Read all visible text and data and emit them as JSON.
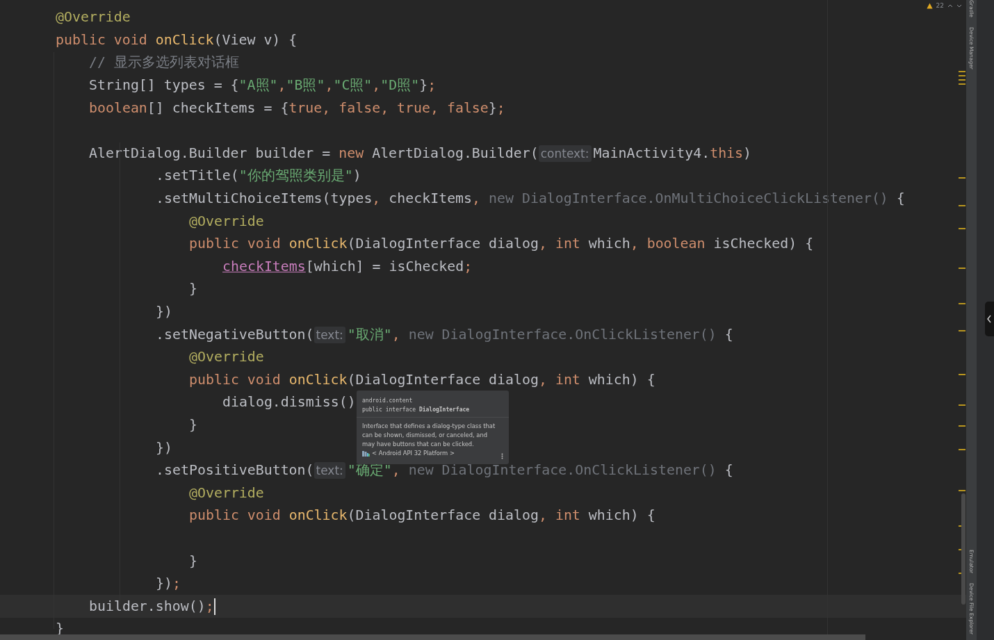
{
  "editor": {
    "lines": [
      {
        "current": false,
        "tokens": [
          {
            "kind": "ann",
            "text": "@Override"
          }
        ]
      },
      {
        "current": false,
        "tokens": [
          {
            "kind": "kw",
            "text": "public void "
          },
          {
            "kind": "fn",
            "text": "onClick"
          },
          {
            "kind": "plain",
            "text": "(View v) {"
          }
        ]
      },
      {
        "current": false,
        "tokens": [
          {
            "kind": "comment",
            "text": "// 显示多选列表对话框"
          }
        ]
      },
      {
        "current": false,
        "tokens": [
          {
            "kind": "plain",
            "text": "String[] types = {"
          },
          {
            "kind": "str",
            "text": "\"A照\""
          },
          {
            "kind": "kw",
            "text": ","
          },
          {
            "kind": "str",
            "text": "\"B照\""
          },
          {
            "kind": "kw",
            "text": ","
          },
          {
            "kind": "str",
            "text": "\"C照\""
          },
          {
            "kind": "kw",
            "text": ","
          },
          {
            "kind": "str",
            "text": "\"D照\""
          },
          {
            "kind": "plain",
            "text": "}"
          },
          {
            "kind": "kw",
            "text": ";"
          }
        ]
      },
      {
        "current": false,
        "tokens": [
          {
            "kind": "kw",
            "text": "boolean"
          },
          {
            "kind": "plain",
            "text": "[] checkItems = {"
          },
          {
            "kind": "kw",
            "text": "true, false, true, false"
          },
          {
            "kind": "plain",
            "text": "}"
          },
          {
            "kind": "kw",
            "text": ";"
          }
        ]
      },
      {
        "current": false
      },
      {
        "current": false,
        "tokens": [
          {
            "kind": "plain",
            "text": "AlertDialog.Builder builder = "
          },
          {
            "kind": "kw",
            "text": "new "
          },
          {
            "kind": "plain",
            "text": "AlertDialog.Builder("
          },
          {
            "kind": "hint",
            "text": "context:"
          },
          {
            "kind": "plain",
            "text": "MainActivity4."
          },
          {
            "kind": "kw",
            "text": "this"
          },
          {
            "kind": "plain",
            "text": ")"
          }
        ]
      },
      {
        "current": false,
        "tokens": [
          {
            "kind": "plain",
            "text": ".setTitle("
          },
          {
            "kind": "str",
            "text": "\"你的驾照类别是\""
          },
          {
            "kind": "plain",
            "text": ")"
          }
        ]
      },
      {
        "current": false,
        "tokens": [
          {
            "kind": "plain",
            "text": ".setMultiChoiceItems(types"
          },
          {
            "kind": "kw",
            "text": ", "
          },
          {
            "kind": "plain",
            "text": "checkItems"
          },
          {
            "kind": "kw",
            "text": ", "
          },
          {
            "kind": "gray",
            "text": "new DialogInterface.OnMultiChoiceClickListener()"
          },
          {
            "kind": "plain",
            "text": " {"
          }
        ]
      },
      {
        "current": false,
        "tokens": [
          {
            "kind": "ann",
            "text": "@Override"
          }
        ]
      },
      {
        "current": false,
        "tokens": [
          {
            "kind": "kw",
            "text": "public void "
          },
          {
            "kind": "fn",
            "text": "onClick"
          },
          {
            "kind": "plain",
            "text": "(DialogInterface dialog"
          },
          {
            "kind": "kw",
            "text": ", int "
          },
          {
            "kind": "plain",
            "text": "which"
          },
          {
            "kind": "kw",
            "text": ", boolean "
          },
          {
            "kind": "plain",
            "text": "isChecked) {"
          }
        ]
      },
      {
        "current": false,
        "tokens": [
          {
            "kind": "field",
            "text": "checkItems"
          },
          {
            "kind": "plain",
            "text": "[which] = isChecked"
          },
          {
            "kind": "kw",
            "text": ";"
          }
        ]
      },
      {
        "current": false,
        "tokens": [
          {
            "kind": "plain",
            "text": "}"
          }
        ]
      },
      {
        "current": false,
        "tokens": [
          {
            "kind": "plain",
            "text": "})"
          }
        ]
      },
      {
        "current": false,
        "tokens": [
          {
            "kind": "plain",
            "text": ".setNegativeButton("
          },
          {
            "kind": "hint",
            "text": "text:"
          },
          {
            "kind": "str",
            "text": "\"取消\""
          },
          {
            "kind": "kw",
            "text": ", "
          },
          {
            "kind": "gray",
            "text": "new DialogInterface.OnClickListener()"
          },
          {
            "kind": "plain",
            "text": " {"
          }
        ]
      },
      {
        "current": false,
        "tokens": [
          {
            "kind": "ann",
            "text": "@Override"
          }
        ]
      },
      {
        "current": false,
        "tokens": [
          {
            "kind": "kw",
            "text": "public void "
          },
          {
            "kind": "fn",
            "text": "onClick"
          },
          {
            "kind": "plain",
            "text": "(DialogInterface dialog"
          },
          {
            "kind": "kw",
            "text": ", int "
          },
          {
            "kind": "plain",
            "text": "which) {"
          }
        ]
      },
      {
        "current": false,
        "tokens": [
          {
            "kind": "plain",
            "text": "dialog.dismiss()"
          }
        ]
      },
      {
        "current": false,
        "tokens": [
          {
            "kind": "plain",
            "text": "}"
          }
        ]
      },
      {
        "current": false,
        "tokens": [
          {
            "kind": "plain",
            "text": "})"
          }
        ]
      },
      {
        "current": false,
        "tokens": [
          {
            "kind": "plain",
            "text": ".setPositiveButton("
          },
          {
            "kind": "hint",
            "text": "text:"
          },
          {
            "kind": "str",
            "text": "\"确定\""
          },
          {
            "kind": "kw",
            "text": ", "
          },
          {
            "kind": "gray",
            "text": "new DialogInterface.OnClickListener()"
          },
          {
            "kind": "plain",
            "text": " {"
          }
        ]
      },
      {
        "current": false,
        "tokens": [
          {
            "kind": "ann",
            "text": "@Override"
          }
        ]
      },
      {
        "current": false,
        "tokens": [
          {
            "kind": "kw",
            "text": "public void "
          },
          {
            "kind": "fn",
            "text": "onClick"
          },
          {
            "kind": "plain",
            "text": "(DialogInterface dialog"
          },
          {
            "kind": "kw",
            "text": ", int "
          },
          {
            "kind": "plain",
            "text": "which) {"
          }
        ]
      },
      {
        "current": false
      },
      {
        "current": false,
        "tokens": [
          {
            "kind": "plain",
            "text": "}"
          }
        ]
      },
      {
        "current": false,
        "tokens": [
          {
            "kind": "plain",
            "text": "})"
          },
          {
            "kind": "kw",
            "text": ";"
          }
        ]
      },
      {
        "current": true,
        "tokens": [
          {
            "kind": "plain",
            "text": "builder.show()"
          },
          {
            "kind": "kw",
            "text": ";"
          }
        ]
      },
      {
        "current": false,
        "tokens": [
          {
            "kind": "plain",
            "text": "}"
          }
        ]
      }
    ]
  },
  "tooltip": {
    "package": "android.content",
    "declaration": "public interface **DialogInterface**",
    "description": "Interface that defines a dialog-type class that can be shown, dismissed, or canceled, and may have buttons that can be clicked.",
    "source": "< Android API 32 Platform >"
  },
  "inspections": {
    "warning_count": "22"
  },
  "tool_strip": {
    "top": [
      "Gradle",
      "Device Manager"
    ],
    "bottom": [
      "Emulator",
      "Device File Explorer"
    ]
  }
}
